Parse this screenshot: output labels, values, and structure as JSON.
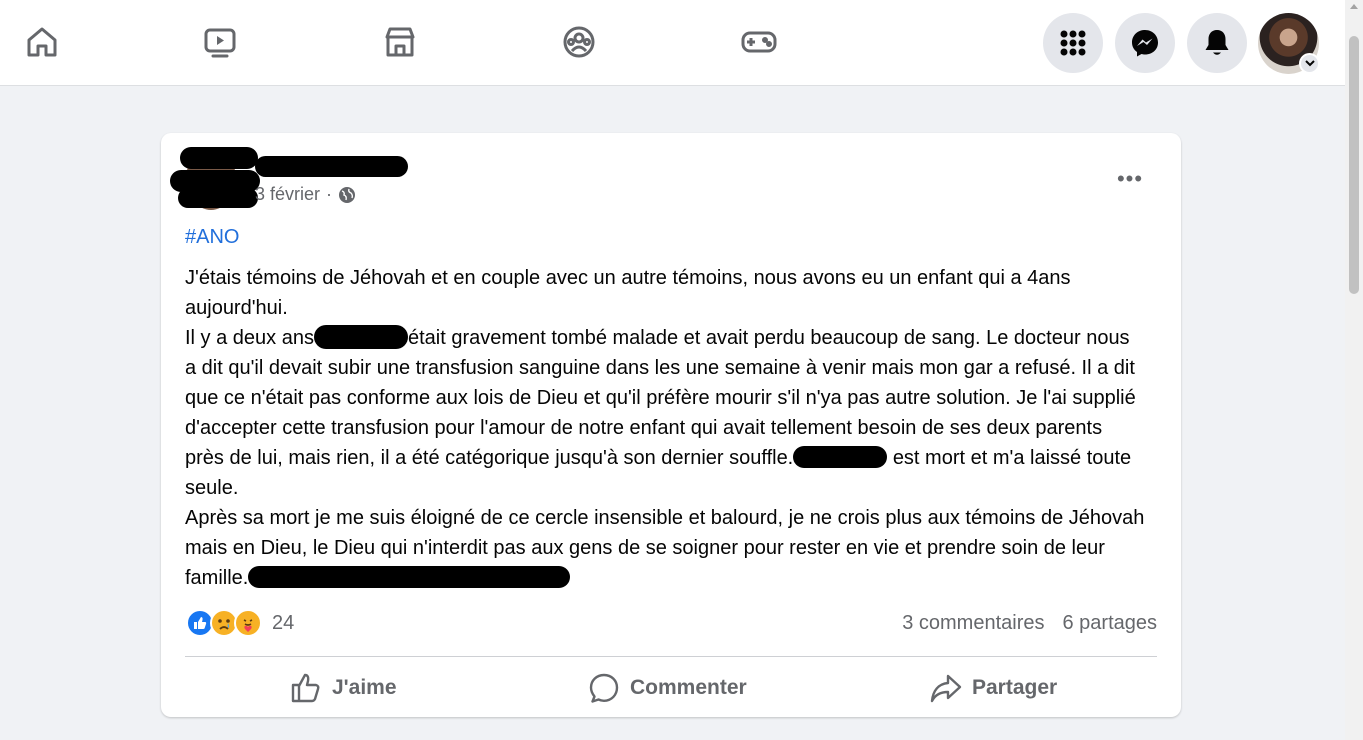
{
  "nav": {
    "icons": [
      "home-icon",
      "video-icon",
      "marketplace-icon",
      "groups-icon",
      "gaming-icon"
    ],
    "right_buttons": [
      "menu-grid-icon",
      "messenger-icon",
      "notifications-icon"
    ]
  },
  "post": {
    "date": "3 février",
    "separator": "·",
    "visibility_icon": "globe-icon",
    "more_label": "•••",
    "hashtag": "#ANO",
    "paragraphs": [
      "J'étais témoins de Jéhovah et en couple avec un autre témoins, nous avons eu un enfant qui a 4ans aujourd'hui.",
      "Il y a deux ans",
      "était gravement tombé malade et avait perdu beaucoup de sang. Le docteur nous a dit qu'il devait subir une transfusion sanguine dans les une semaine à venir mais mon gar a refusé. Il a dit que ce n'était pas conforme aux lois de Dieu et qu'il préfère mourir s'il n'ya pas autre solution. Je l'ai supplié d'accepter cette transfusion pour l'amour de notre enfant qui avait tellement besoin de ses deux parents près de lui, mais rien, il a été catégorique jusqu'à son dernier souffle.",
      "est mort et m'a laissé toute seule.",
      "Après sa mort je me suis éloigné de ce cercle insensible et balourd, je ne crois plus aux témoins de Jéhovah mais en Dieu, le Dieu qui n'interdit pas aux gens de se soigner pour rester en vie et prendre soin de leur famille."
    ],
    "reactions": {
      "types": [
        "like",
        "sad",
        "care"
      ],
      "count": "24"
    },
    "comments_label": "3 commentaires",
    "shares_label": "6 partages",
    "actions": {
      "like": "J'aime",
      "comment": "Commenter",
      "share": "Partager"
    }
  },
  "colors": {
    "background": "#f0f2f5",
    "link": "#216fdb",
    "secondary_text": "#65676b",
    "like_blue": "#1877f2",
    "sad_yellow": "#f7b125"
  }
}
